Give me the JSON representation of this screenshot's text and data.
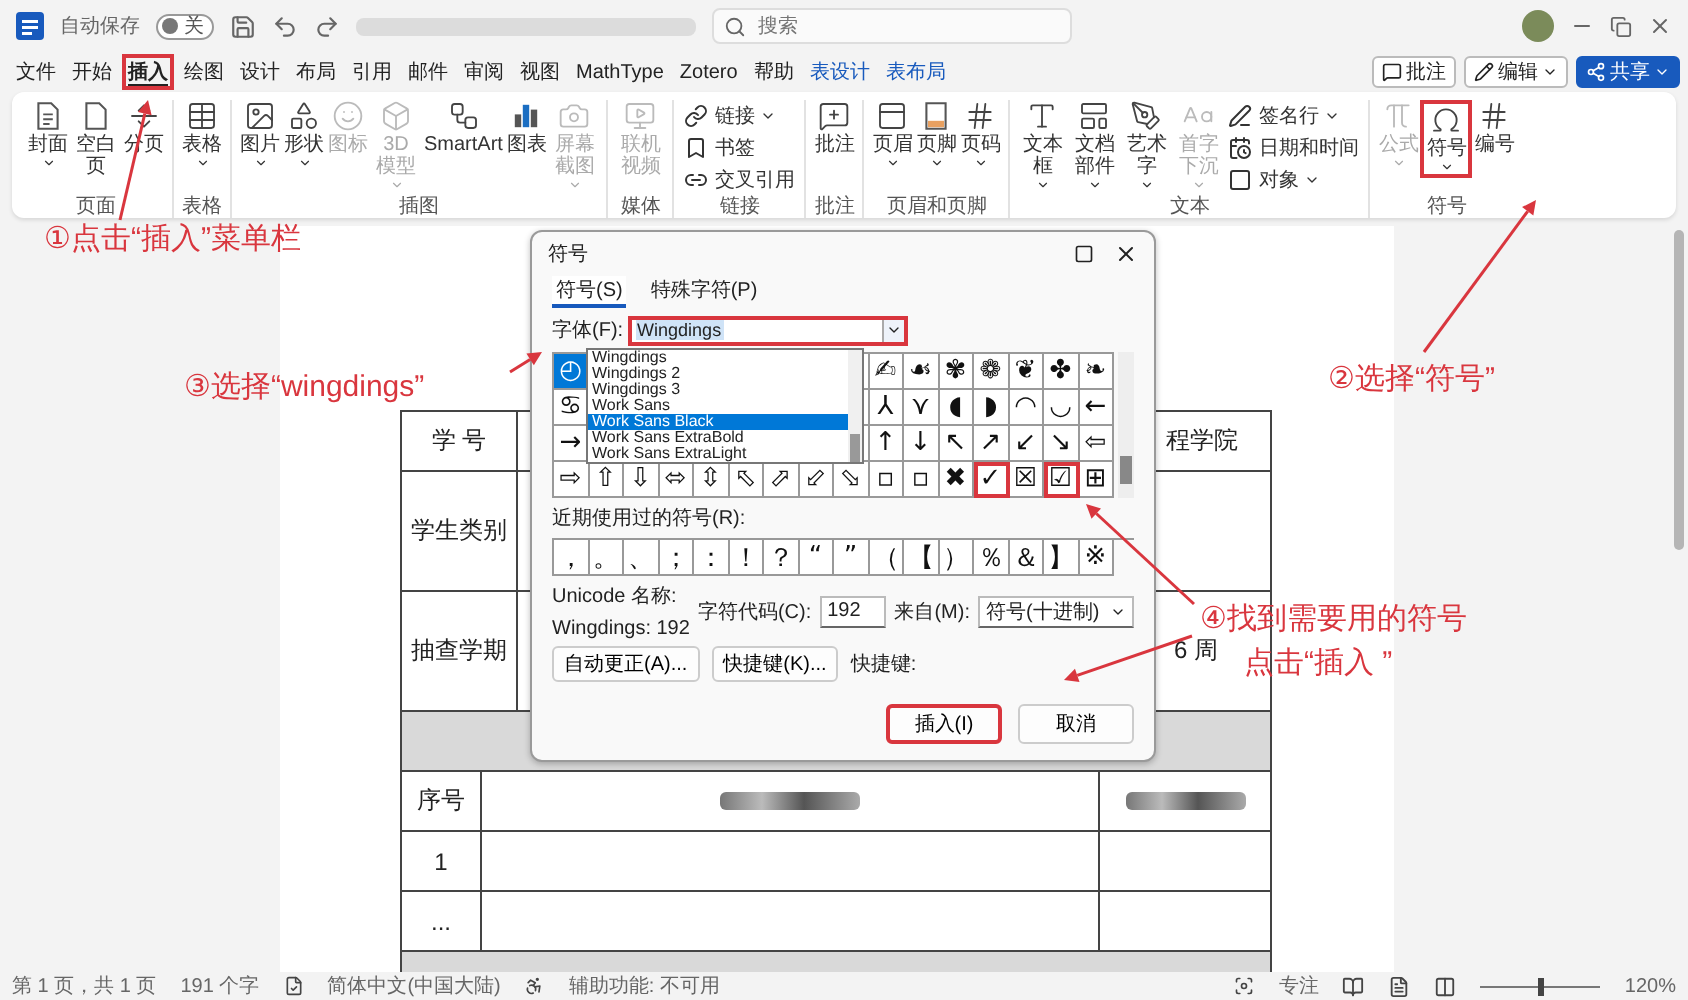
{
  "title_bar": {
    "autosave_label": "自动保存",
    "autosave_toggle": {
      "on": false,
      "label": "关"
    },
    "search": {
      "placeholder": "搜索"
    }
  },
  "menu_tabs": [
    {
      "label": "文件",
      "selected": false,
      "kind": "normal"
    },
    {
      "label": "开始",
      "selected": false,
      "kind": "normal"
    },
    {
      "label": "插入",
      "selected": true,
      "kind": "normal",
      "annotated": true
    },
    {
      "label": "绘图",
      "selected": false,
      "kind": "normal"
    },
    {
      "label": "设计",
      "selected": false,
      "kind": "normal"
    },
    {
      "label": "布局",
      "selected": false,
      "kind": "normal"
    },
    {
      "label": "引用",
      "selected": false,
      "kind": "normal"
    },
    {
      "label": "邮件",
      "selected": false,
      "kind": "normal"
    },
    {
      "label": "审阅",
      "selected": false,
      "kind": "normal"
    },
    {
      "label": "视图",
      "selected": false,
      "kind": "normal"
    },
    {
      "label": "MathType",
      "selected": false,
      "kind": "normal"
    },
    {
      "label": "Zotero",
      "selected": false,
      "kind": "normal"
    },
    {
      "label": "帮助",
      "selected": false,
      "kind": "normal"
    },
    {
      "label": "表设计",
      "selected": false,
      "kind": "context"
    },
    {
      "label": "表布局",
      "selected": false,
      "kind": "context"
    }
  ],
  "menu_buttons": [
    {
      "label": "批注",
      "kind": "comment"
    },
    {
      "label": "编辑",
      "kind": "edit"
    },
    {
      "label": "共享",
      "kind": "share"
    }
  ],
  "ribbon_groups": [
    {
      "label": "页面",
      "items": [
        {
          "label": "封面",
          "kind": "large",
          "dropdown": true
        },
        {
          "label": "空白页",
          "kind": "large"
        },
        {
          "label": "分页",
          "kind": "large"
        }
      ]
    },
    {
      "label": "表格",
      "items": [
        {
          "label": "表格",
          "kind": "large",
          "dropdown": true
        }
      ]
    },
    {
      "label": "插图",
      "items": [
        {
          "label": "图片",
          "kind": "large",
          "dropdown": true
        },
        {
          "label": "形状",
          "kind": "large",
          "dropdown": true
        },
        {
          "label": "图标",
          "kind": "large",
          "disabled": true
        },
        {
          "label": "3D 模型",
          "kind": "large",
          "dropdown": true,
          "disabled": true
        },
        {
          "label": "SmartArt",
          "kind": "large"
        },
        {
          "label": "图表",
          "kind": "large"
        },
        {
          "label": "屏幕截图",
          "kind": "large",
          "dropdown": true,
          "disabled": true
        }
      ]
    },
    {
      "label": "媒体",
      "items": [
        {
          "label": "联机视频",
          "kind": "large",
          "disabled": true
        }
      ]
    },
    {
      "label": "链接",
      "items": [
        {
          "label": "链接",
          "kind": "small",
          "dropdown": true
        },
        {
          "label": "书签",
          "kind": "small"
        },
        {
          "label": "交叉引用",
          "kind": "small"
        }
      ]
    },
    {
      "label": "批注",
      "items": [
        {
          "label": "批注",
          "kind": "large"
        }
      ]
    },
    {
      "label": "页眉和页脚",
      "items": [
        {
          "label": "页眉",
          "kind": "large",
          "dropdown": true
        },
        {
          "label": "页脚",
          "kind": "large",
          "dropdown": true
        },
        {
          "label": "页码",
          "kind": "large",
          "dropdown": true
        }
      ]
    },
    {
      "label": "文本",
      "items": [
        {
          "label": "文本框",
          "kind": "large",
          "dropdown": true
        },
        {
          "label": "文档部件",
          "kind": "large",
          "dropdown": true
        },
        {
          "label": "艺术字",
          "kind": "large",
          "dropdown": true
        },
        {
          "label": "首字下沉",
          "kind": "large",
          "dropdown": true,
          "disabled": true
        },
        {
          "label": "签名行",
          "kind": "small",
          "dropdown": true
        },
        {
          "label": "日期和时间",
          "kind": "small"
        },
        {
          "label": "对象",
          "kind": "small",
          "dropdown": true
        }
      ]
    },
    {
      "label": "符号",
      "items": [
        {
          "label": "公式",
          "kind": "large",
          "dropdown": true,
          "disabled": true
        },
        {
          "label": "符号",
          "kind": "large",
          "dropdown": true,
          "annotated": true
        },
        {
          "label": "编号",
          "kind": "large"
        }
      ]
    }
  ],
  "document": {
    "top_rows": [
      {
        "label": "学 号",
        "value": "程学院"
      },
      {
        "label": "学生类别"
      },
      {
        "label": "抽查学期",
        "value": "6 周"
      }
    ],
    "lower_rows": [
      {
        "number": "序号",
        "redacted": true
      },
      {
        "number": "1"
      },
      {
        "number": "..."
      }
    ]
  },
  "dialog": {
    "title": "符号",
    "tabs": [
      {
        "label": "符号(S)",
        "selected": true
      },
      {
        "label": "特殊字符(P)",
        "selected": false
      }
    ],
    "font": {
      "label": "字体(F):",
      "value": "Wingdings",
      "annotated": true
    },
    "font_list": [
      {
        "label": "Wingdings",
        "selected": false
      },
      {
        "label": "Wingdings 2",
        "selected": false
      },
      {
        "label": "Wingdings 3",
        "selected": false
      },
      {
        "label": "Work Sans",
        "selected": false
      },
      {
        "label": "Work Sans Black",
        "selected": true
      },
      {
        "label": "Work Sans ExtraBold",
        "selected": false
      },
      {
        "label": "Work Sans ExtraLight",
        "selected": false
      }
    ],
    "symbol_rows": [
      {
        "left": [
          {
            "symbol": "◴",
            "selected": true
          }
        ],
        "right": [
          {
            "symbol": "✍",
            "selected": false
          },
          {
            "symbol": "☙",
            "selected": false
          },
          {
            "symbol": "✾",
            "selected": false
          },
          {
            "symbol": "❁",
            "selected": false
          },
          {
            "symbol": "❦",
            "selected": false
          },
          {
            "symbol": "✤",
            "selected": false
          },
          {
            "symbol": "❧",
            "selected": false
          }
        ]
      },
      {
        "left": [
          {
            "symbol": "♋",
            "selected": false
          }
        ],
        "right": [
          {
            "symbol": "⅄",
            "selected": false
          },
          {
            "symbol": "⋎",
            "selected": false
          },
          {
            "symbol": "◖",
            "selected": false
          },
          {
            "symbol": "◗",
            "selected": false
          },
          {
            "symbol": "◠",
            "selected": false
          },
          {
            "symbol": "◡",
            "selected": false
          },
          {
            "symbol": "←",
            "selected": false
          }
        ]
      },
      {
        "left": [
          {
            "symbol": "→",
            "selected": false
          }
        ],
        "right": [
          {
            "symbol": "↑",
            "selected": false
          },
          {
            "symbol": "↓",
            "selected": false
          },
          {
            "symbol": "↖",
            "selected": false
          },
          {
            "symbol": "↗",
            "selected": false
          },
          {
            "symbol": "↙",
            "selected": false
          },
          {
            "symbol": "↘",
            "selected": false
          },
          {
            "symbol": "⇦",
            "selected": false
          }
        ]
      },
      {
        "left": [
          {
            "symbol": "⇨",
            "selected": false
          },
          {
            "symbol": "⇧",
            "selected": false
          },
          {
            "symbol": "⇩",
            "selected": false
          },
          {
            "symbol": "⬄",
            "selected": false
          },
          {
            "symbol": "⇳",
            "selected": false
          },
          {
            "symbol": "⬁",
            "selected": false
          },
          {
            "symbol": "⬀",
            "selected": false
          },
          {
            "symbol": "⬃",
            "selected": false
          },
          {
            "symbol": "⬂",
            "selected": false
          },
          {
            "symbol": "▫",
            "selected": false
          },
          {
            "symbol": "▫",
            "selected": false
          },
          {
            "symbol": "✖",
            "selected": false
          },
          {
            "symbol": "✓",
            "selected": false,
            "annotated": true
          },
          {
            "symbol": "☒",
            "selected": false
          },
          {
            "symbol": "☑",
            "selected": false,
            "annotated": true
          },
          {
            "symbol": "⊞",
            "selected": false
          }
        ]
      }
    ],
    "recent_label": "近期使用过的符号(R):",
    "recent": [
      "，",
      "。",
      "、",
      "；",
      "：",
      "！",
      "？",
      "“",
      "”",
      "（",
      "【",
      "）",
      "％",
      "＆",
      "】",
      "※"
    ],
    "unicode_label": "Unicode 名称:",
    "unicode_value": "Wingdings: 192",
    "char_code": {
      "label": "字符代码(C):",
      "value": "192"
    },
    "from": {
      "label": "来自(M):",
      "value": "符号(十进制)"
    },
    "buttons": [
      {
        "label": "自动更正(A)..."
      },
      {
        "label": "快捷键(K)..."
      }
    ],
    "shortcut_label": "快捷键:",
    "actions": [
      {
        "label": "插入(I)",
        "annotated": true
      },
      {
        "label": "取消"
      }
    ]
  },
  "annotations": [
    {
      "text": "①点击“插入”菜单栏"
    },
    {
      "text": "③选择“wingdings”"
    },
    {
      "text": "②选择“符号”"
    },
    {
      "text": "④找到需要用的符号"
    },
    {
      "text": "点击“插入 ”"
    }
  ],
  "status_bar": {
    "left": [
      "第 1 页，共 1 页",
      "191 个字",
      "简体中文(中国大陆)",
      "辅助功能: 不可用"
    ],
    "focus": "专注",
    "zoom": {
      "level": 0.5,
      "reading": "120%"
    }
  }
}
